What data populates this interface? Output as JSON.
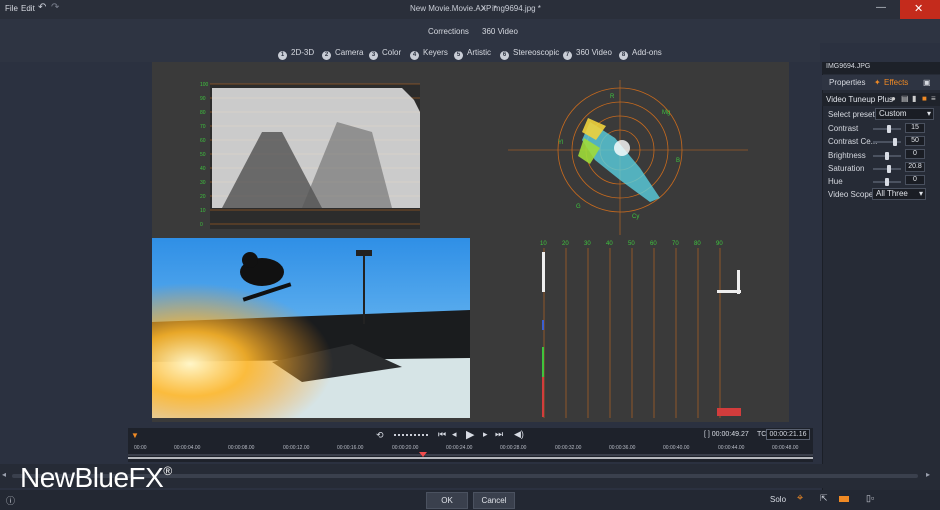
{
  "menu": {
    "file": "File",
    "edit": "Edit"
  },
  "window": {
    "project_title": "New Movie.Movie.AXP *",
    "separator": ">",
    "image_title": "img9694.jpg *"
  },
  "top_tabs": {
    "corrections": "Corrections",
    "video360": "360 Video"
  },
  "categories": [
    {
      "num": "1",
      "label": "2D-3D"
    },
    {
      "num": "2",
      "label": "Camera"
    },
    {
      "num": "3",
      "label": "Color"
    },
    {
      "num": "4",
      "label": "Keyers"
    },
    {
      "num": "5",
      "label": "Artistic"
    },
    {
      "num": "6",
      "label": "Stereoscopic"
    },
    {
      "num": "7",
      "label": "360 Video"
    },
    {
      "num": "8",
      "label": "Add-ons"
    }
  ],
  "waveform": {
    "ticks": [
      "100",
      "90",
      "80",
      "70",
      "60",
      "50",
      "40",
      "30",
      "20",
      "10",
      "0"
    ]
  },
  "vectorscope": {
    "labels": [
      "R",
      "Mg",
      "B",
      "Cy",
      "G",
      "Yl"
    ]
  },
  "histogram": {
    "ticks": [
      "10",
      "20",
      "30",
      "40",
      "50",
      "60",
      "70",
      "80",
      "90"
    ]
  },
  "panel": {
    "file_name": "IMG9694.JPG",
    "tab_properties": "Properties",
    "tab_effects": "Effects",
    "effect_title": "Video Tuneup Plus",
    "preset_label": "Select preset",
    "preset_value": "Custom",
    "params": [
      {
        "label": "Contrast",
        "value": "15",
        "level": 0.6
      },
      {
        "label": "Contrast Ce...",
        "value": "50",
        "level": 0.85
      },
      {
        "label": "Brightness",
        "value": "0",
        "level": 0.5
      },
      {
        "label": "Saturation",
        "value": "20.8",
        "level": 0.6
      },
      {
        "label": "Hue",
        "value": "0",
        "level": 0.5
      }
    ],
    "scopes_label": "Video Scopes",
    "scopes_value": "All Three"
  },
  "timeline": {
    "position": "[ ] 00:00:49.27",
    "tc_label": "TC",
    "tc_value": "00:00:21.16",
    "ruler": [
      "00:00",
      "00:00:04.00",
      "00:00:08.00",
      "00:00:12.00",
      "00:00:16.00",
      "00:00:20.00",
      "00:00:24.00",
      "00:00:28.00",
      "00:00:32.00",
      "00:00:36.00",
      "00:00:40.00",
      "00:00:44.00",
      "00:00:48.00"
    ]
  },
  "bottom": {
    "ok": "OK",
    "cancel": "Cancel",
    "solo": "Solo"
  },
  "brand": {
    "logo": "NewBlueFX",
    "mark": "®"
  },
  "colors": {
    "accent": "#f08a24",
    "scope_green": "#3ec43e",
    "bg": "#2b3140"
  }
}
